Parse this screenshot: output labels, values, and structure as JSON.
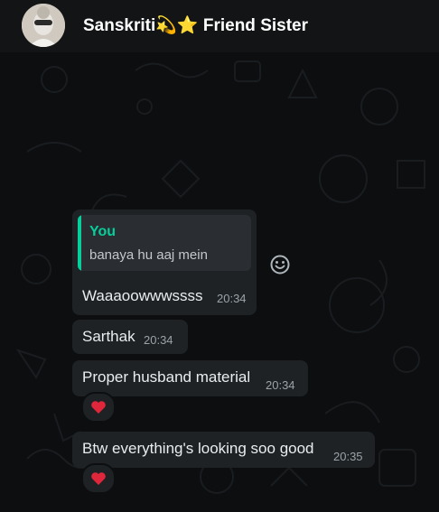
{
  "header": {
    "contact_name": "Sanskriti💫⭐ Friend Sister",
    "avatar_icon": "profile-photo"
  },
  "colors": {
    "bubble": "#1f2225",
    "quote_accent": "#06cf9c",
    "reaction_heart": "#e0263a"
  },
  "messages": [
    {
      "reply": {
        "author": "You",
        "text": "banaya hu aaj mein"
      },
      "text": "Waaaoowwwssss",
      "time": "20:34"
    },
    {
      "text": "Sarthak",
      "time": "20:34"
    },
    {
      "text": "Proper husband material",
      "time": "20:34",
      "reaction": "heart-icon"
    },
    {
      "text": "Btw everything's looking soo good",
      "time": "20:35",
      "reaction": "heart-icon"
    }
  ],
  "emoji_button_icon": "smiley-icon"
}
